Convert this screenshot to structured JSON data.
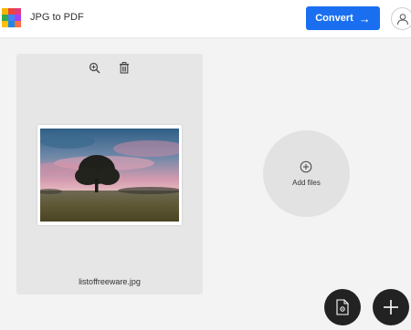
{
  "header": {
    "app_title": "JPG to PDF",
    "convert_label": "Convert",
    "convert_arrow": "→",
    "accent_color": "#1a6ff0"
  },
  "logo": {
    "icon": "app-logo-grid",
    "colors": [
      "#f4b400",
      "#e8453c",
      "#e63b7a",
      "#34a853",
      "#4285f4",
      "#a142f4",
      "#ffc107",
      "#1e88e5",
      "#ff7043"
    ]
  },
  "file_card": {
    "file_name": "listoffreeware.jpg",
    "zoom_icon": "zoom-in-icon",
    "delete_icon": "trash-icon",
    "thumbnail": "landscape photo with tree under pink sunset sky"
  },
  "add_files": {
    "label": "Add files",
    "icon": "plus-circle-icon"
  },
  "fab": {
    "document_icon": "document-settings-icon",
    "add_icon": "plus-icon"
  }
}
